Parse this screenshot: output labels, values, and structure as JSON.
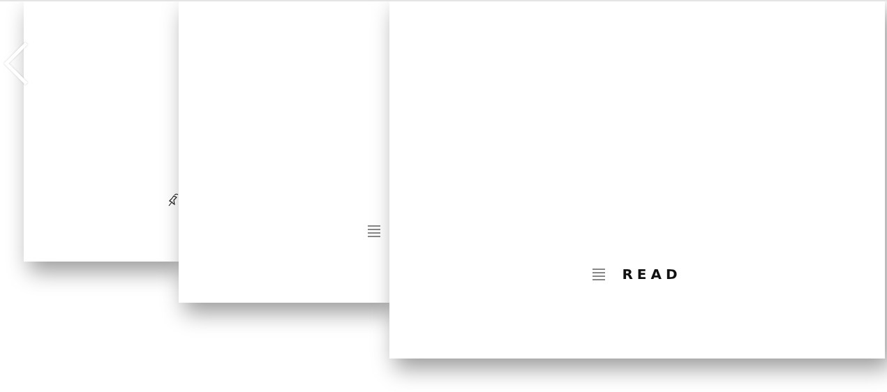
{
  "cards": [
    {
      "kind": "pin"
    },
    {
      "kind": "list"
    },
    {
      "kind": "list",
      "label": "READ"
    }
  ]
}
